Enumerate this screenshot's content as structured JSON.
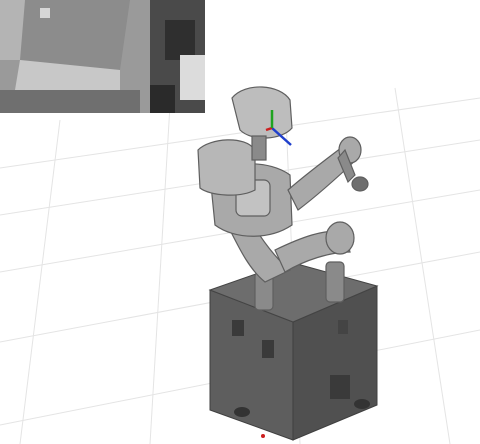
{
  "scene": {
    "background_color": "#ffffff",
    "grid_color": "#e4e4e4",
    "base_color": "#585858",
    "robot_color": "#a9a9a9",
    "robot_shadow_color": "#6e6e6e",
    "axis_colors": {
      "x": "#cc1f1f",
      "y": "#1fa31f",
      "z": "#1f3fcc"
    }
  },
  "camera_inset": {
    "icon": "camera-feed",
    "floor_color": "#9a9a9a",
    "wall_color": "#c8c8c8",
    "shadow_color": "#3a3a3a"
  }
}
